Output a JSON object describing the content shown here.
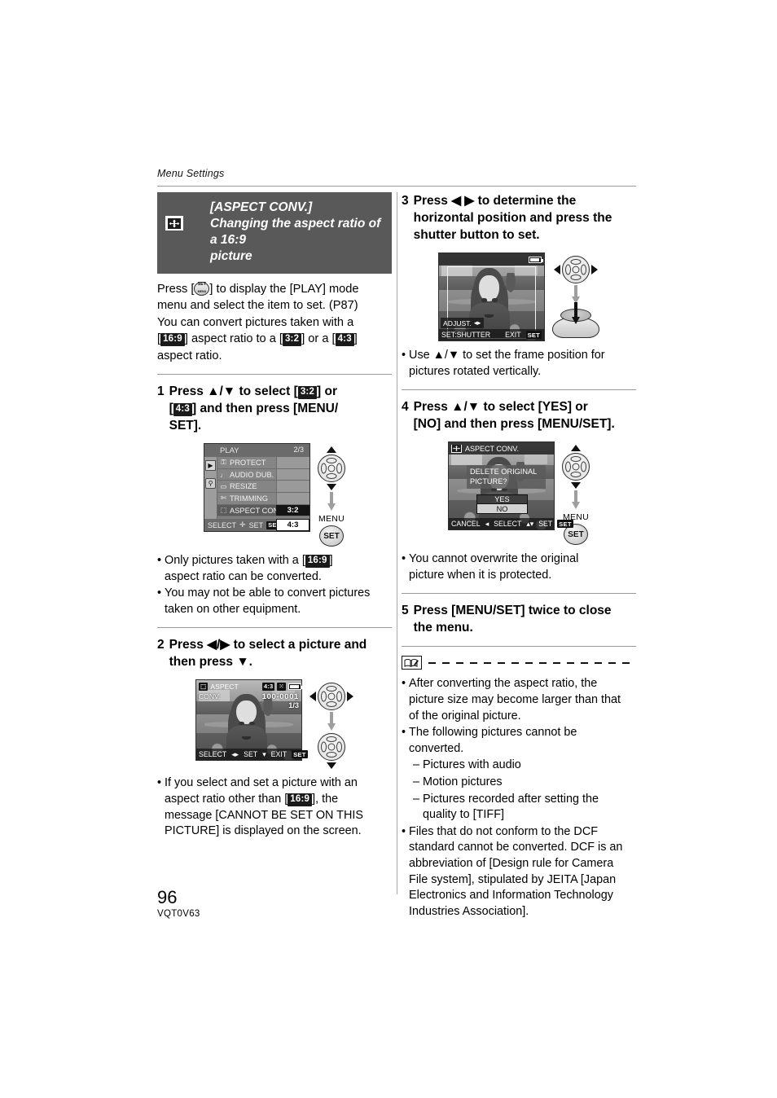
{
  "running_head": "Menu Settings",
  "banner": {
    "icon": "four-way-arrow-icon",
    "title": "[ASPECT CONV.]",
    "subtitle_line1": "Changing the aspect ratio of a 16:9",
    "subtitle_line2": "picture"
  },
  "intro": {
    "l1_a": "Press [",
    "l1_b": "] to display the [PLAY] mode",
    "l2": "menu and select the item to set. (P87)",
    "l3": "You can convert pictures taken with a",
    "l4_a": "[",
    "l4_badge1": "16:9",
    "l4_b": "] aspect ratio to a [",
    "l4_badge2": "3:2",
    "l4_c": "] or a [",
    "l4_badge3": "4:3",
    "l4_d": "]",
    "l5": "aspect ratio."
  },
  "steps": {
    "s1": {
      "num": "1",
      "t_a": "Press ▲/▼ to select [",
      "badge1": "3:2",
      "t_b": "] or",
      "t_c": "[",
      "badge2": "4:3",
      "t_d": "] and then press [MENU/",
      "t_e": "SET]."
    },
    "s2": {
      "num": "2",
      "t_a": "Press ◀/▶ to select a picture and",
      "t_b": "then press ▼."
    },
    "s3": {
      "num": "3",
      "t_a": "Press ◀  ▶ to determine the",
      "t_b": "horizontal position and press the",
      "t_c": "shutter button to set."
    },
    "s4": {
      "num": "4",
      "t_a": "Press ▲/▼ to select [YES] or",
      "t_b": "[NO] and then press [MENU/SET]."
    },
    "s5": {
      "num": "5",
      "t_a": "Press [MENU/SET] twice to close",
      "t_b": "the menu."
    }
  },
  "play_menu_screen": {
    "title": "PLAY",
    "page_indicator": "2/3",
    "tab_icons": [
      "play-tab-icon",
      "wrench-tab-icon"
    ],
    "rows": [
      {
        "icon": "key-icon",
        "label": "PROTECT",
        "value": "",
        "selected": false
      },
      {
        "icon": "mic-icon",
        "label": "AUDIO DUB.",
        "value": "",
        "selected": false
      },
      {
        "icon": "resize-icon",
        "label": "RESIZE",
        "value": "",
        "selected": false
      },
      {
        "icon": "scissors-icon",
        "label": "TRIMMING",
        "value": "",
        "selected": false
      },
      {
        "icon": "aspect-icon",
        "label": "ASPECT CONV.",
        "value": "3:2",
        "selected": true
      }
    ],
    "footer_select": "SELECT",
    "footer_set": "SET",
    "option_value": "4:3"
  },
  "select_picture_screen": {
    "header_label_1": "ASPECT",
    "header_label_2": "CONV.",
    "size_chip": "4:3",
    "quality_icon": "fine-quality-icon",
    "battery_icon": "battery-full-icon",
    "file_number": "100-0001",
    "frame_counter": "1/3",
    "footer_select": "SELECT",
    "footer_set": "SET",
    "footer_exit": "EXIT"
  },
  "adjust_screen": {
    "battery_icon": "battery-full-icon",
    "adjust_label": "ADJUST.",
    "set_label": "SET:SHUTTER",
    "exit_label": "EXIT"
  },
  "confirm_screen": {
    "title": "ASPECT CONV.",
    "title_icon": "four-way-arrow-icon",
    "message_line1": "DELETE ORIGINAL",
    "message_line2": "PICTURE?",
    "options": [
      "YES",
      "NO"
    ],
    "selected_option": "YES",
    "footer_cancel": "CANCEL",
    "footer_select": "SELECT",
    "footer_set": "SET"
  },
  "controls": {
    "menu_label": "MENU",
    "set_label": "SET"
  },
  "notes_step1": [
    {
      "a": "Only pictures taken with a [",
      "badge": "16:9",
      "b": "]"
    },
    {
      "a": "aspect ratio can be converted.",
      "badge": "",
      "b": ""
    },
    {
      "a": "You may not be able to convert pictures",
      "badge": "",
      "b": ""
    },
    {
      "a": "taken on other equipment.",
      "badge": "",
      "b": ""
    }
  ],
  "note_step2": {
    "l1": "If you select and set a picture with an",
    "l2_a": "aspect ratio other than [",
    "l2_badge": "16:9",
    "l2_b": "], the",
    "l3": "message [CANNOT BE SET ON THIS",
    "l4": "PICTURE] is displayed on the screen."
  },
  "note_step3": {
    "l1": "Use ▲/▼ to set the frame position for",
    "l2": "pictures rotated vertically."
  },
  "note_step4": {
    "l1": "You cannot overwrite the original",
    "l2": "picture when it is protected."
  },
  "notes_block": {
    "icon": "note-book-pencil-icon",
    "items": [
      {
        "type": "bullet",
        "lines": [
          "After converting the aspect ratio, the",
          "picture size may become larger than that",
          "of the original picture."
        ]
      },
      {
        "type": "bullet",
        "lines": [
          "The following pictures cannot be",
          "converted."
        ]
      },
      {
        "type": "dash",
        "lines": [
          "Pictures with audio"
        ]
      },
      {
        "type": "dash",
        "lines": [
          "Motion pictures"
        ]
      },
      {
        "type": "dash",
        "lines": [
          "Pictures recorded after setting the",
          "quality to [TIFF]"
        ]
      },
      {
        "type": "bullet",
        "lines": [
          "Files that do not conform to the DCF",
          "standard cannot be converted. DCF is an",
          "abbreviation of [Design rule for Camera",
          "File system], stipulated by JEITA [Japan",
          "Electronics and Information Technology",
          "Industries Association]."
        ]
      }
    ]
  },
  "footer": {
    "page_number": "96",
    "doc_code": "VQT0V63"
  }
}
